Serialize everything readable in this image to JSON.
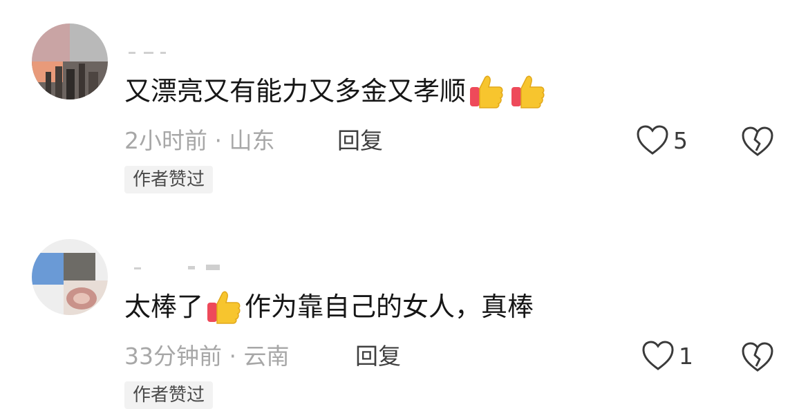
{
  "comments": [
    {
      "text_parts": [
        "又漂亮又有能力又多金又孝顺"
      ],
      "time": "2小时前",
      "location": "山东",
      "reply_label": "回复",
      "like_count": "5",
      "badge": "作者赞过",
      "emoji": "thumbs-up-icon"
    },
    {
      "text_parts": [
        "太棒了",
        "作为靠自己的女人，真棒"
      ],
      "time": "33分钟前",
      "location": "云南",
      "reply_label": "回复",
      "like_count": "1",
      "badge": "作者赞过",
      "emoji": "thumbs-up-icon"
    }
  ],
  "separator": " · ",
  "colors": {
    "meta": "#a7a7a7",
    "text": "#161616",
    "badge_bg": "#f2f2f2",
    "thumb_yellow": "#f7c52e",
    "thumb_red": "#ee4a5a"
  }
}
